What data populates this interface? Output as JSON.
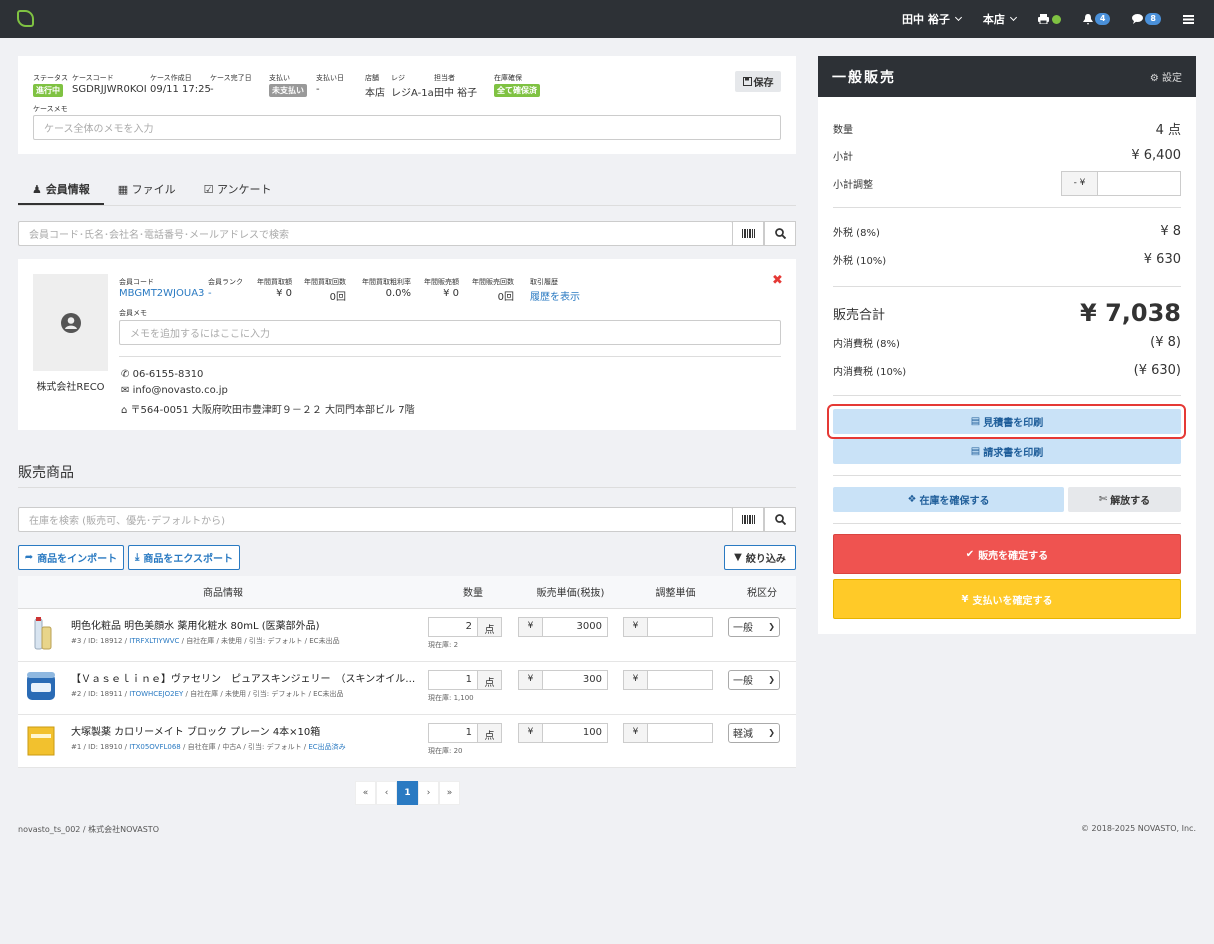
{
  "topbar": {
    "user": "田中 裕子",
    "store": "本店",
    "notifications": "4",
    "messages": "8"
  },
  "case": {
    "status_label": "ステータス",
    "status_value": "進行中",
    "status_color": "#7fc242",
    "code_label": "ケースコード",
    "code_value": "SGDRJJWR0KOI",
    "created_label": "ケース作成日",
    "created_value": "09/11 17:25",
    "completed_label": "ケース完了日",
    "completed_value": "-",
    "payment_label": "支払い",
    "payment_value": "未支払い",
    "payment_color": "#999999",
    "paydate_label": "支払い日",
    "paydate_value": "-",
    "shop_label": "店舗",
    "shop_value": "本店",
    "register_label": "レジ",
    "register_value": "レジA-1a",
    "staff_label": "担当者",
    "staff_value": "田中 裕子",
    "stock_label": "在庫確保",
    "stock_value": "全て確保済",
    "save_label": "保存",
    "memo_label": "ケースメモ",
    "memo_placeholder": "ケース全体のメモを入力"
  },
  "tabs": [
    {
      "label": "会員情報"
    },
    {
      "label": "ファイル"
    },
    {
      "label": "アンケート"
    }
  ],
  "member_search_placeholder": "会員コード･氏名･会社名･電話番号･メールアドレスで検索",
  "member": {
    "name": "株式会社RECO",
    "code_label": "会員コード",
    "code_value": "MBGMT2WJOUA3",
    "rank_label": "会員ランク",
    "rank_value": "-",
    "buy_amount_label": "年間買取額",
    "buy_amount_value": "¥ 0",
    "buy_count_label": "年間買取回数",
    "buy_count_value": "0回",
    "buy_margin_label": "年間買取粗利率",
    "buy_margin_value": "0.0%",
    "sell_amount_label": "年間販売額",
    "sell_amount_value": "¥ 0",
    "sell_count_label": "年間販売回数",
    "sell_count_value": "0回",
    "history_label": "取引履歴",
    "history_value": "履歴を表示",
    "memo_label": "会員メモ",
    "memo_placeholder": "メモを追加するにはここに入力",
    "phone": "06-6155-8310",
    "email": "info@novasto.co.jp",
    "address": "〒564-0051 大阪府吹田市豊津町９－２２ 大同門本部ビル 7階"
  },
  "products": {
    "title": "販売商品",
    "search_placeholder": "在庫を検索 (販売可、優先･デフォルトから)",
    "import_label": "商品をインポート",
    "export_label": "商品をエクスポート",
    "filter_label": "絞り込み",
    "headers": [
      "商品情報",
      "数量",
      "販売単価(税抜)",
      "調整単価",
      "税区分"
    ],
    "items": [
      {
        "name": "明色化粧品 明色美顔水 薬用化粧水 80mL (医薬部外品)",
        "meta": "#3 / ID: 18912 / ",
        "code": "ITRFXLTIYWVC",
        "meta2": " / 自社在庫 / 未使用 / 引当: デフォルト / EC未出品",
        "meta2_link": "",
        "qty": "2",
        "unit": "点",
        "stock": "現在庫: 2",
        "price": "3000",
        "tax": "一般"
      },
      {
        "name": "【Ｖａｓｅｌｉｎｅ】ヴァセリン　ピュアスキンジェリー　（スキンオイル）　２００…",
        "meta": "#2 / ID: 18911 / ",
        "code": "ITOWHCEJO2EY",
        "meta2": " / 自社在庫 / 未使用 / 引当: デフォルト / EC未出品",
        "meta2_link": "",
        "qty": "1",
        "unit": "点",
        "stock": "現在庫: 1,100",
        "price": "300",
        "tax": "一般"
      },
      {
        "name": "大塚製薬 カロリーメイト ブロック プレーン 4本×10箱",
        "meta": "#1 / ID: 18910 / ",
        "code": "ITX05OVFL068",
        "meta2": " / 自社在庫 / 中古A / 引当: デフォルト / ",
        "meta2_link": "EC出品済み",
        "qty": "1",
        "unit": "点",
        "stock": "現在庫: 20",
        "price": "100",
        "tax": "軽減"
      }
    ],
    "yen": "¥"
  },
  "pager": {
    "first": "«",
    "prev": "‹",
    "current": "1",
    "next": "›",
    "last": "»"
  },
  "footer": {
    "left": "novasto_ts_002 / 株式会社NOVASTO",
    "right": "© 2018-2025 NOVASTO, Inc."
  },
  "sale": {
    "title": "一般販売",
    "settings_label": "設定",
    "qty_label": "数量",
    "qty_value": "4 点",
    "subtotal_label": "小計",
    "subtotal_value": "¥ 6,400",
    "adjust_label": "小計調整",
    "adjust_prefix": "- ¥",
    "tax8_label": "外税 (8%)",
    "tax8_value": "¥ 8",
    "tax10_label": "外税 (10%)",
    "tax10_value": "¥ 630",
    "total_label": "販売合計",
    "total_value": "¥ 7,038",
    "intax8_label": "内消費税 (8%)",
    "intax8_value": "(¥ 8)",
    "intax10_label": "内消費税 (10%)",
    "intax10_value": "(¥ 630)",
    "estimate_label": "見積書を印刷",
    "invoice_label": "請求書を印刷",
    "reserve_label": "在庫を確保する",
    "release_label": "解放する",
    "confirm_sale_label": "販売を確定する",
    "confirm_pay_label": "支払いを確定する",
    "colors": {
      "red": "#ef5350",
      "yellow": "#ffca28",
      "lightblue": "#c9e2f7",
      "highlight": "#e53935"
    }
  }
}
